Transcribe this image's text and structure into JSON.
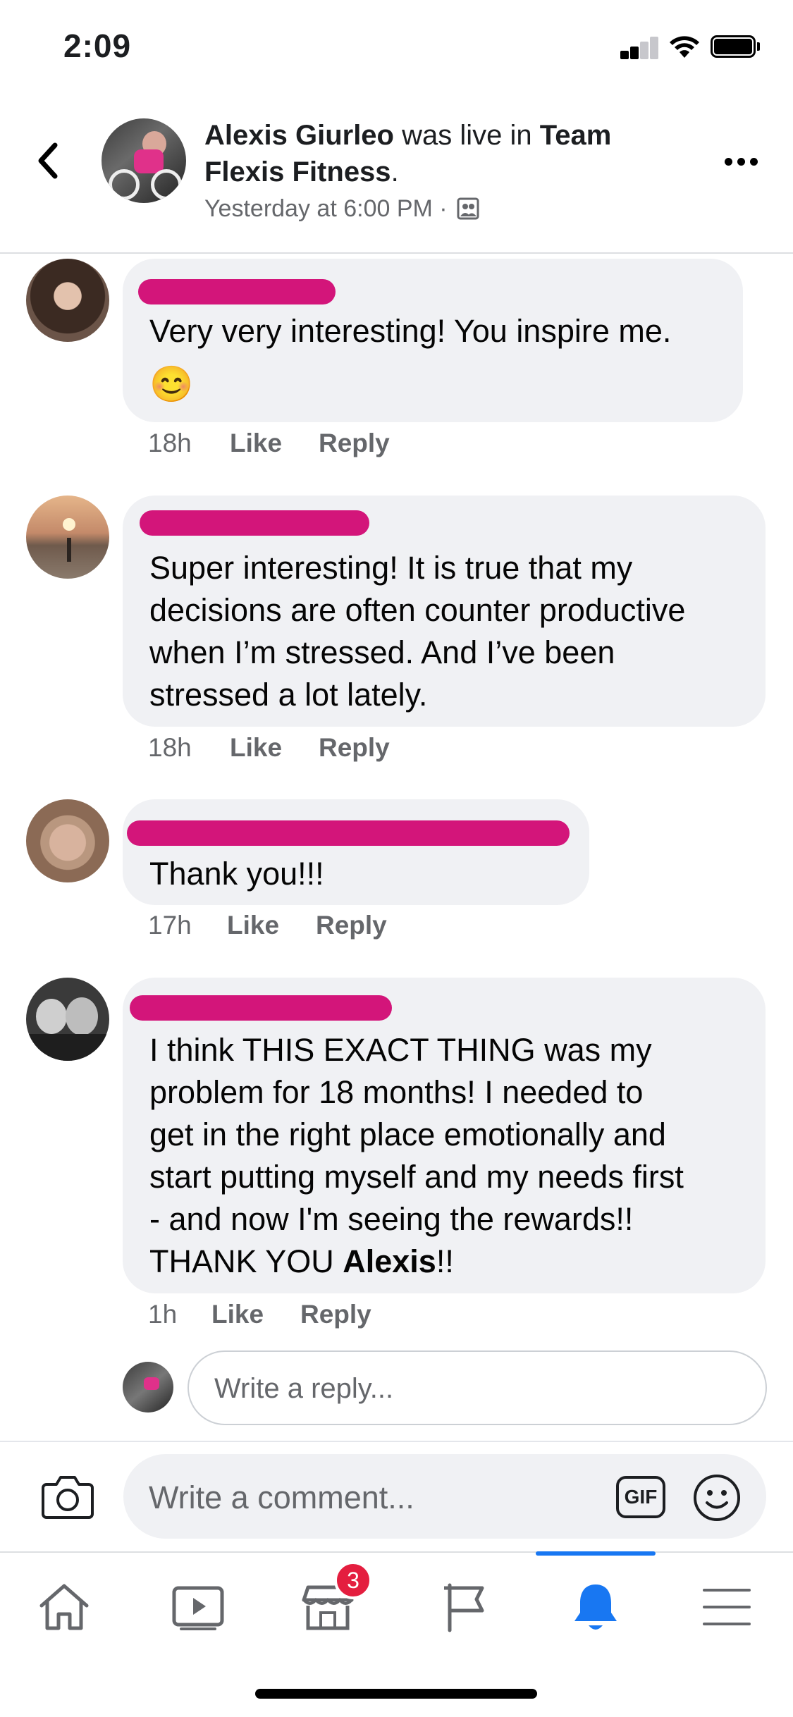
{
  "status_bar": {
    "time": "2:09"
  },
  "header": {
    "author": "Alexis Giurleo",
    "connector": " was live in ",
    "group_line1": "Team",
    "group_line2": "Flexis Fitness",
    "period": ".",
    "timestamp": "Yesterday at 6:00 PM ·"
  },
  "comments": [
    {
      "text_lines": [
        "Very very interesting! You inspire me."
      ],
      "emoji": "😊",
      "time": "18h",
      "like": "Like",
      "reply": "Reply"
    },
    {
      "text_lines": [
        "Super interesting! It is true that my",
        "decisions are often counter productive",
        "when I’m stressed. And I’ve been",
        "stressed a lot lately."
      ],
      "time": "18h",
      "like": "Like",
      "reply": "Reply"
    },
    {
      "text_lines": [
        "Thank you!!!"
      ],
      "time": "17h",
      "like": "Like",
      "reply": "Reply"
    },
    {
      "text_lines": [
        "I think THIS EXACT THING was my",
        "problem for 18 months! I needed to",
        "get in the right place emotionally and",
        "start putting myself and my needs first",
        "- and now I'm seeing the rewards!!"
      ],
      "last_line_start": "THANK YOU ",
      "last_line_bold": "Alexis",
      "last_line_end": "!!",
      "time": "1h",
      "like": "Like",
      "reply": "Reply"
    }
  ],
  "reply_input": {
    "placeholder": "Write a reply..."
  },
  "comment_bar": {
    "placeholder": "Write a comment...",
    "gif_label": "GIF"
  },
  "tab_bar": {
    "tabs": [
      {
        "icon": "home-icon"
      },
      {
        "icon": "watch-icon"
      },
      {
        "icon": "marketplace-icon",
        "badge": "3"
      },
      {
        "icon": "pages-flag-icon"
      },
      {
        "icon": "notifications-bell-icon",
        "active": true
      },
      {
        "icon": "menu-icon"
      }
    ]
  },
  "colors": {
    "accent": "#1877f2",
    "redaction": "#d3157a",
    "bubble": "#f0f1f4",
    "badge": "#e41e3f"
  }
}
